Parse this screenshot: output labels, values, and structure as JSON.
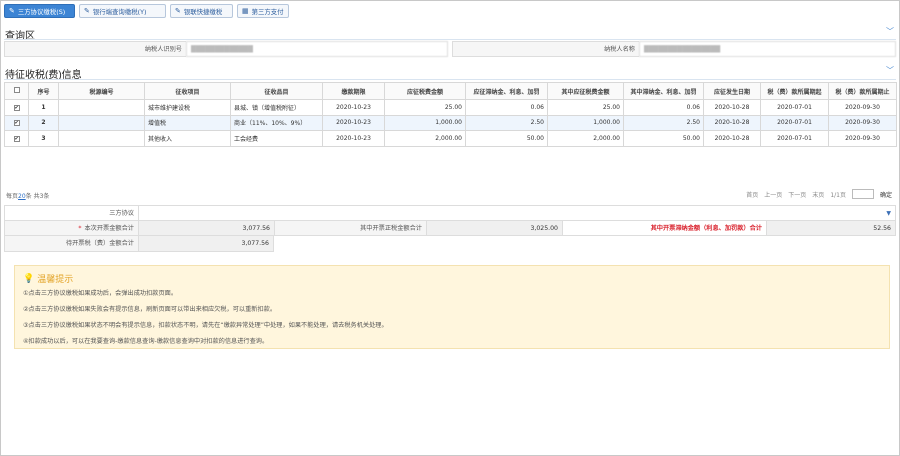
{
  "toolbar": {
    "buttons": [
      {
        "label": "三方协议缴税(S)",
        "icon": "pencil-icon"
      },
      {
        "label": "银行端查询缴税(Y)",
        "icon": "pencil-icon"
      },
      {
        "label": "银联快捷缴税",
        "icon": "pencil-icon"
      },
      {
        "label": "第三方支付",
        "icon": "grid-icon"
      }
    ]
  },
  "query": {
    "title": "查询区",
    "taxpayer_id_label": "纳税人识别号",
    "taxpayer_id_value": "█████████████",
    "taxpayer_name_label": "纳税人名称",
    "taxpayer_name_value": "████████████████"
  },
  "pending": {
    "title": "待征收税(费)信息",
    "columns": [
      "序号",
      "税源编号",
      "征收项目",
      "征收品目",
      "缴款期限",
      "应征税费金额",
      "应征滞纳金、利息、加罚",
      "其中应征税费金额",
      "其中滞纳金、利息、加罚",
      "应征发生日期",
      "税（费）款所属期起",
      "税（费）款所属期止"
    ],
    "rows": [
      {
        "no": "1",
        "source": "",
        "item": "城市维护建设税",
        "sub": "县城、镇（增值税附征）",
        "deadline": "2020-10-23",
        "amount": "25.00",
        "late": "0.06",
        "inner_amount": "25.00",
        "inner_late": "0.06",
        "date": "2020-10-28",
        "start": "2020-07-01",
        "end": "2020-09-30"
      },
      {
        "no": "2",
        "source": "",
        "item": "增值税",
        "sub": "商业（11%、10%、9%）",
        "deadline": "2020-10-23",
        "amount": "1,000.00",
        "late": "2.50",
        "inner_amount": "1,000.00",
        "inner_late": "2.50",
        "date": "2020-10-28",
        "start": "2020-07-01",
        "end": "2020-09-30"
      },
      {
        "no": "3",
        "source": "",
        "item": "其他收入",
        "sub": "工会经费",
        "deadline": "2020-10-23",
        "amount": "2,000.00",
        "late": "50.00",
        "inner_amount": "2,000.00",
        "inner_late": "50.00",
        "date": "2020-10-28",
        "start": "2020-07-01",
        "end": "2020-09-30"
      }
    ]
  },
  "pager": {
    "per_page_prefix": "每页",
    "per_page": "20",
    "per_page_suffix": "条 共3条",
    "first": "首页",
    "prev": "上一页",
    "next": "下一页",
    "last": "末页",
    "page_info": "1/1页",
    "go": "确定"
  },
  "summary": {
    "agreement_label": "三方协议",
    "total_label": "本次开票金额合计",
    "total_value": "3,077.56",
    "tax_label": "其中开票正税金额合计",
    "tax_value": "3,025.00",
    "late_label": "其中开票滞纳金额（利息、加罚款）合计",
    "late_value": "52.56",
    "pending_label": "待开票税（费）金额合计",
    "pending_value": "3,077.56"
  },
  "tips": {
    "title": "温馨提示",
    "lines": [
      "①点击三方协议缴税如果成功后，会弹出成功扣款页面。",
      "②点击三方协议缴税如果失败会有提示信息，刷新页面可以带出来相应欠税，可以重新扣款。",
      "③点击三方协议缴税如果状态不明会有提示信息，扣款状态不明，请先在“缴款异常处理”中处理，如果不能处理，请去税务机关处理。",
      "④扣款成功以后，可以在我要查询-缴款信息查询-缴款信息查询中对扣款的信息进行查询。"
    ]
  },
  "colors": {
    "accent": "#3c84d4",
    "tip_bg": "#fff6dd",
    "warn": "#d9232e"
  }
}
